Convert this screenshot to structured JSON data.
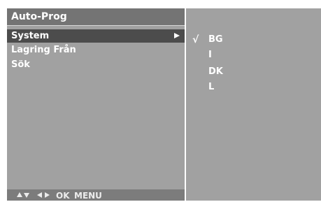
{
  "menu": {
    "title": "Auto-Prog",
    "items": [
      {
        "label": "System",
        "selected": true,
        "has_submenu": true
      },
      {
        "label": "Lagring Från",
        "selected": false,
        "has_submenu": false
      },
      {
        "label": "Sök",
        "selected": false,
        "has_submenu": false
      }
    ],
    "nav_hint": {
      "icons": [
        "up-arrow-icon",
        "down-arrow-icon",
        "left-arrow-icon",
        "right-arrow-icon"
      ],
      "ok_label": "OK",
      "menu_label": "MENU"
    }
  },
  "submenu": {
    "check_mark": "√",
    "options": [
      {
        "label": "BG",
        "checked": true
      },
      {
        "label": "I",
        "checked": false
      },
      {
        "label": "DK",
        "checked": false
      },
      {
        "label": "L",
        "checked": false
      }
    ]
  },
  "colors": {
    "panel_bg": "#a1a1a1",
    "title_bg": "#747474",
    "selected_bg": "#4c4c4c",
    "hint_bg": "#7c7c7c",
    "text": "#ffffff"
  }
}
